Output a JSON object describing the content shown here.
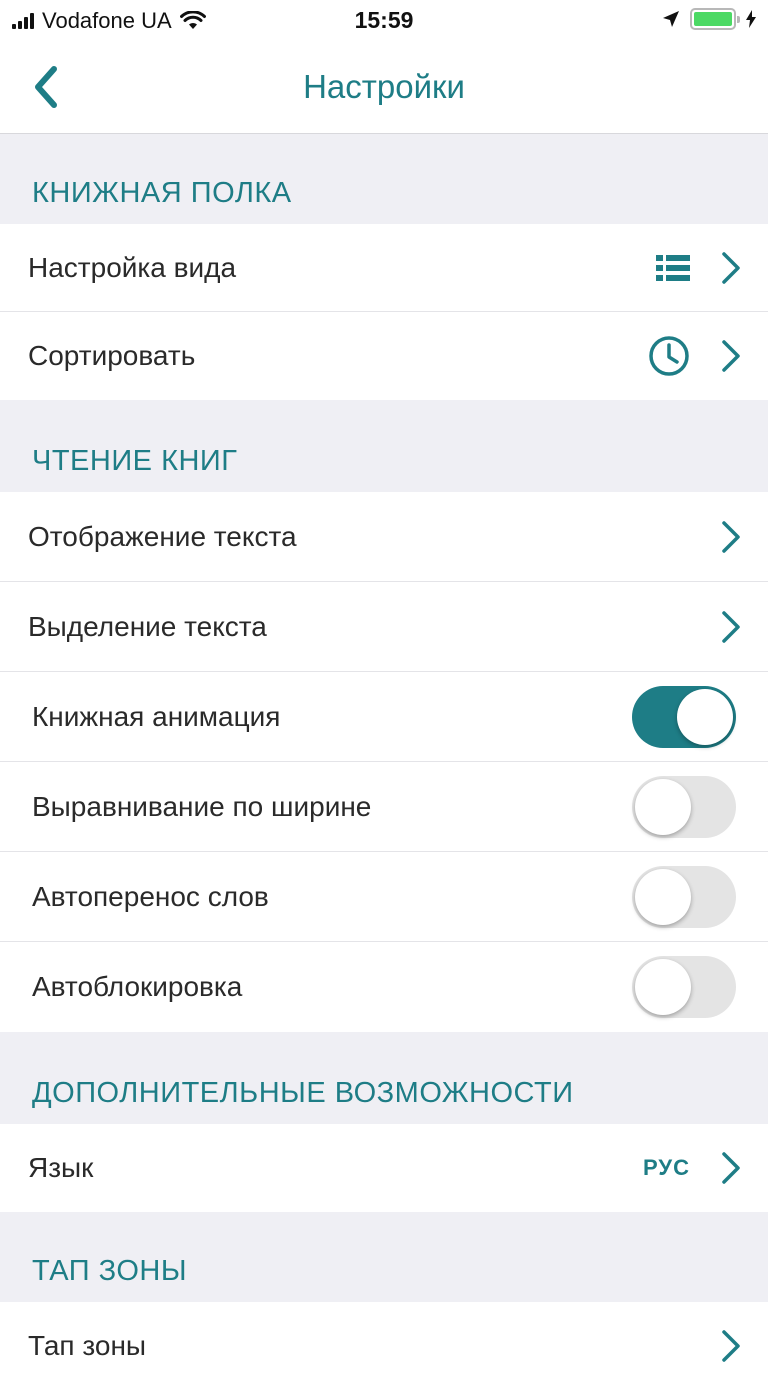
{
  "status_bar": {
    "carrier": "Vodafone UA",
    "time": "15:59",
    "battery_level": 1.0
  },
  "nav": {
    "title": "Настройки",
    "back_icon": "chevron-left-icon"
  },
  "sections": {
    "bookshelf": {
      "header": "КНИЖНАЯ ПОЛКА",
      "view_settings": {
        "label": "Настройка вида",
        "icon": "list-icon"
      },
      "sort": {
        "label": "Сортировать",
        "icon": "clock-icon"
      }
    },
    "reading": {
      "header": "ЧТЕНИЕ КНИГ",
      "text_display": {
        "label": "Отображение текста"
      },
      "text_selection": {
        "label": "Выделение текста"
      },
      "book_animation": {
        "label": "Книжная анимация",
        "enabled": true
      },
      "justify": {
        "label": "Выравнивание по ширине",
        "enabled": false
      },
      "hyphenation": {
        "label": "Автоперенос слов",
        "enabled": false
      },
      "autolock": {
        "label": "Автоблокировка",
        "enabled": false
      }
    },
    "extra": {
      "header": "ДОПОЛНИТЕЛЬНЫЕ ВОЗМОЖНОСТИ",
      "language": {
        "label": "Язык",
        "value": "РУС"
      }
    },
    "tap_zones": {
      "header": "ТАП ЗОНЫ",
      "tap_zones_item": {
        "label": "Тап зоны"
      }
    }
  },
  "colors": {
    "accent": "#1e7d86",
    "background": "#efeff4",
    "toggle_off": "#e4e4e4",
    "battery": "#4cd964"
  }
}
